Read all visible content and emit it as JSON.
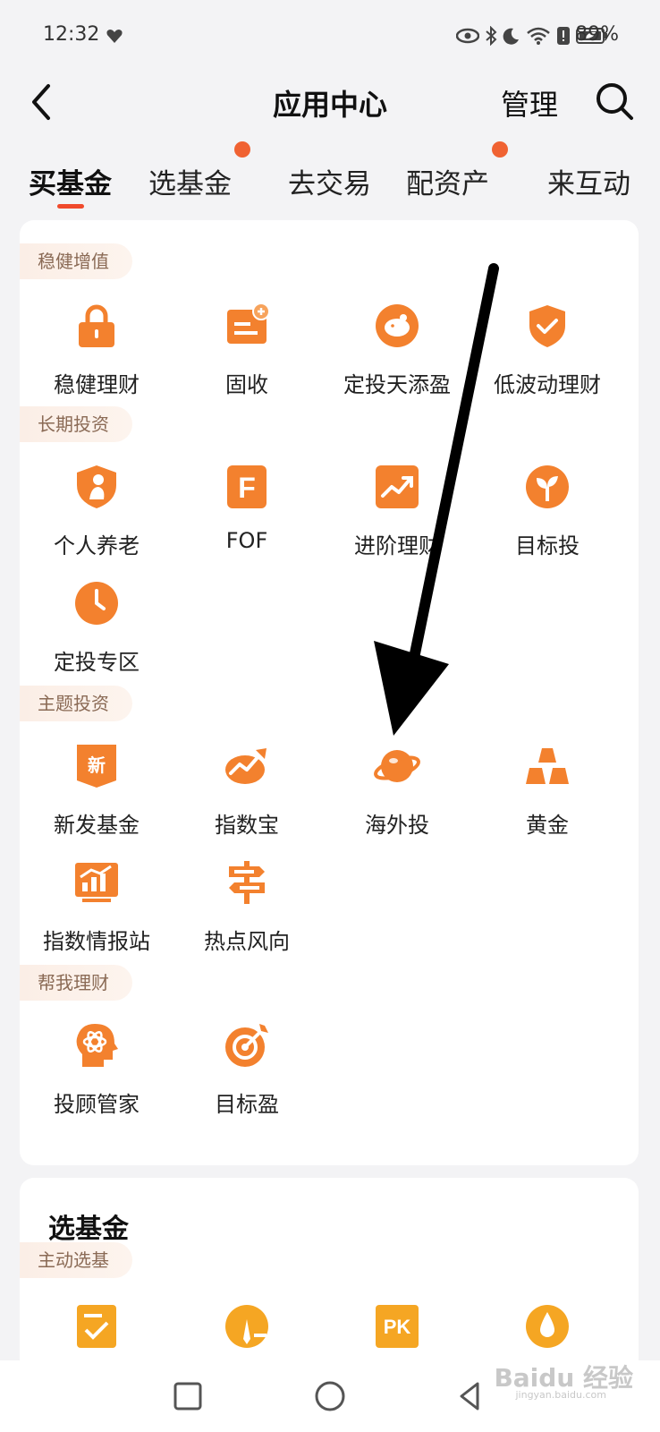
{
  "status_bar": {
    "time": "12:32",
    "battery": "89%"
  },
  "header": {
    "title": "应用中心",
    "manage": "管理"
  },
  "tabs": [
    {
      "label": "买基金"
    },
    {
      "label": "选基金"
    },
    {
      "label": "去交易"
    },
    {
      "label": "配资产"
    },
    {
      "label": "来互动"
    }
  ],
  "sections": [
    {
      "tag": "稳健增值",
      "items": [
        "稳健理财",
        "固收",
        "定投天添盈",
        "低波动理财"
      ]
    },
    {
      "tag": "长期投资",
      "items": [
        "个人养老",
        "FOF",
        "进阶理财",
        "目标投",
        "定投专区"
      ]
    },
    {
      "tag": "主题投资",
      "items": [
        "新发基金",
        "指数宝",
        "海外投",
        "黄金",
        "指数情报站",
        "热点风向"
      ]
    },
    {
      "tag": "帮我理财",
      "items": [
        "投顾管家",
        "目标盈"
      ]
    }
  ],
  "card2": {
    "title": "选基金",
    "tag": "主动选基",
    "pk_text": "PK"
  },
  "icon_glyphs": {
    "fof": "F",
    "new_fund": "新"
  },
  "colors": {
    "accent": "#f04a2c",
    "icon_orange": "#f3812e",
    "tab_dot": "#f06232"
  },
  "watermark": {
    "brand": "Baidu 经验",
    "sub": "jingyan.baidu.com"
  }
}
